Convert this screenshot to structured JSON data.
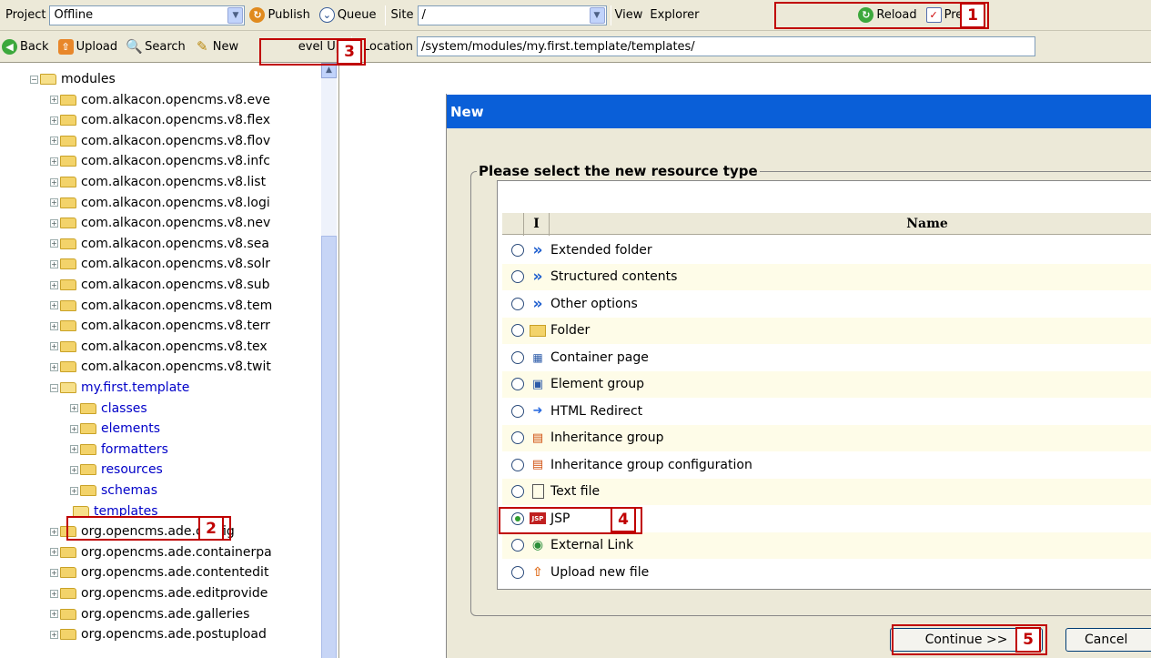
{
  "toolbar1": {
    "project_label": "Project",
    "project_value": "Offline",
    "publish_label": "Publish",
    "queue_label": "Queue",
    "site_label": "Site",
    "site_value": "/",
    "view_label": "View",
    "view_value": "Explorer",
    "reload_label": "Reload",
    "preferences_label": "Pref"
  },
  "toolbar2": {
    "back_label": "Back",
    "upload_label": "Upload",
    "search_label": "Search",
    "new_label": "New",
    "levelup_label": "evel Up",
    "location_label": "Location",
    "location_value": "/system/modules/my.first.template/templates/"
  },
  "tree": {
    "root": "modules",
    "items": [
      "com.alkacon.opencms.v8.eve",
      "com.alkacon.opencms.v8.flex",
      "com.alkacon.opencms.v8.flov",
      "com.alkacon.opencms.v8.infc",
      "com.alkacon.opencms.v8.list",
      "com.alkacon.opencms.v8.logi",
      "com.alkacon.opencms.v8.nev",
      "com.alkacon.opencms.v8.sea",
      "com.alkacon.opencms.v8.solr",
      "com.alkacon.opencms.v8.sub",
      "com.alkacon.opencms.v8.tem",
      "com.alkacon.opencms.v8.terr",
      "com.alkacon.opencms.v8.tex",
      "com.alkacon.opencms.v8.twit"
    ],
    "module": "my.first.template",
    "subfolders": [
      "classes",
      "elements",
      "formatters",
      "resources",
      "schemas"
    ],
    "selected": "templates",
    "after": [
      "org.opencms.ade.config",
      "org.opencms.ade.containerpa",
      "org.opencms.ade.contentedit",
      "org.opencms.ade.editprovide",
      "org.opencms.ade.galleries",
      "org.opencms.ade.postupload"
    ]
  },
  "dialog": {
    "title": "New",
    "legend": "Please select the new resource type",
    "col_icon": "I",
    "col_name": "Name",
    "types": [
      {
        "label": "Extended folder",
        "icon": "chevrons-icon",
        "selected": false
      },
      {
        "label": "Structured contents",
        "icon": "chevrons-icon",
        "selected": false
      },
      {
        "label": "Other options",
        "icon": "chevrons-icon",
        "selected": false
      },
      {
        "label": "Folder",
        "icon": "folder-icon",
        "selected": false
      },
      {
        "label": "Container page",
        "icon": "container-page-icon",
        "selected": false
      },
      {
        "label": "Element group",
        "icon": "element-group-icon",
        "selected": false
      },
      {
        "label": "HTML Redirect",
        "icon": "redirect-icon",
        "selected": false
      },
      {
        "label": "Inheritance group",
        "icon": "inheritance-icon",
        "selected": false
      },
      {
        "label": "Inheritance group configuration",
        "icon": "inheritance-icon",
        "selected": false
      },
      {
        "label": "Text file",
        "icon": "text-file-icon",
        "selected": false
      },
      {
        "label": "JSP",
        "icon": "jsp-icon",
        "selected": true
      },
      {
        "label": "External Link",
        "icon": "external-link-icon",
        "selected": false
      },
      {
        "label": "Upload new file",
        "icon": "upload-icon",
        "selected": false
      }
    ],
    "continue_label": "Continue >>",
    "cancel_label": "Cancel"
  },
  "callouts": [
    "1",
    "2",
    "3",
    "4",
    "5"
  ],
  "colors": {
    "callout": "#c00000",
    "dialog_header": "#0a5fd8",
    "toolbar": "#ece9d8"
  }
}
